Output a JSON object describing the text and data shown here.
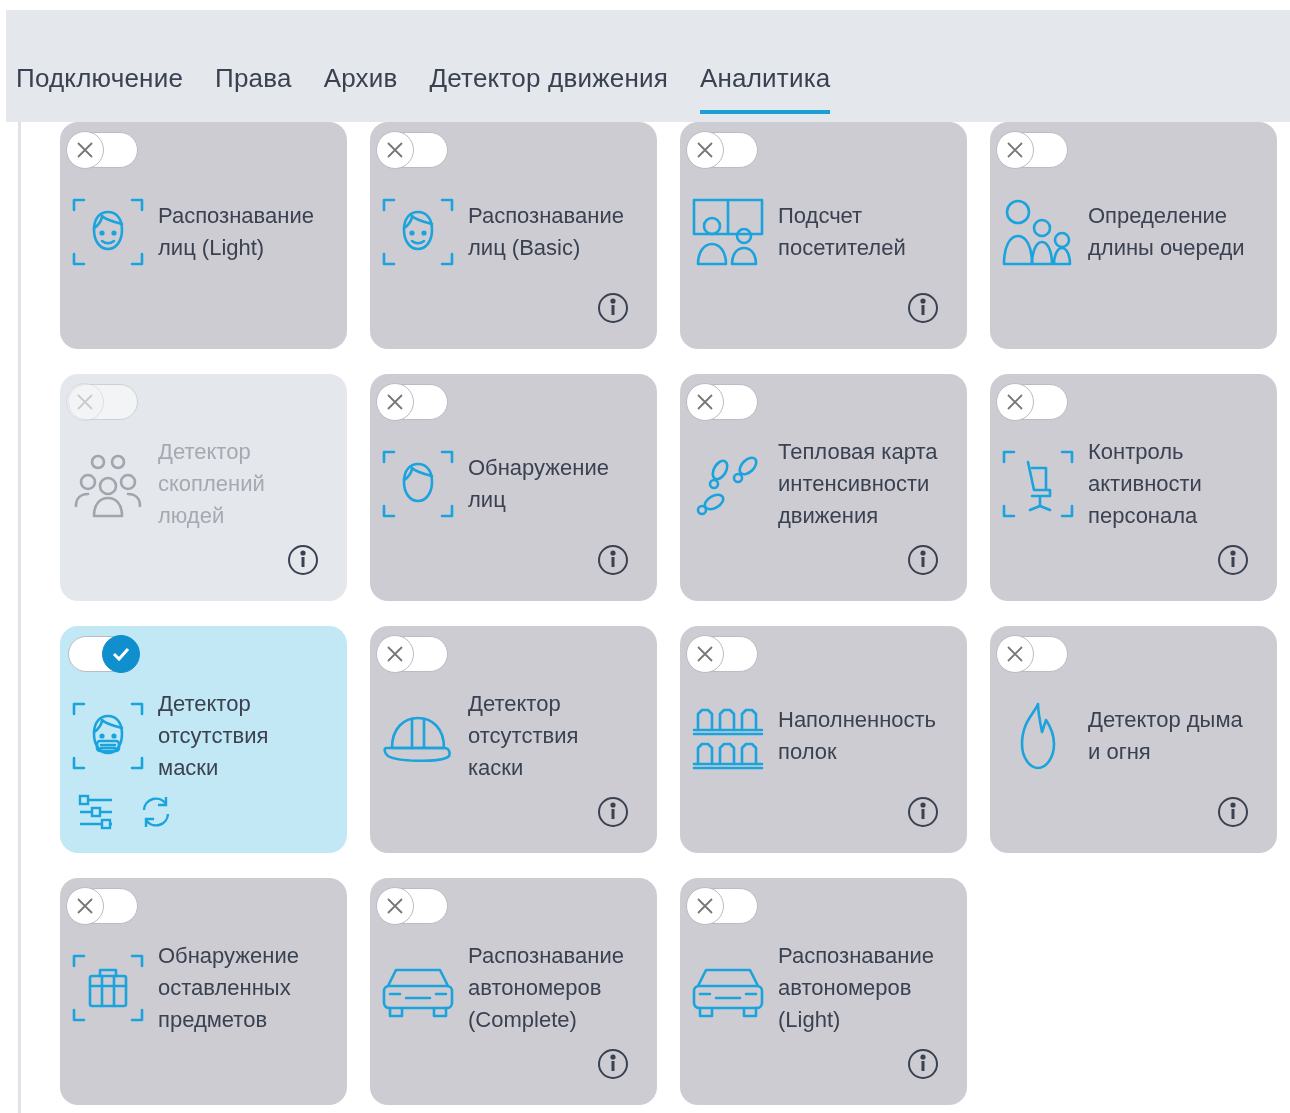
{
  "tabs": [
    {
      "label": "Подключение",
      "selected": false
    },
    {
      "label": "Права",
      "selected": false
    },
    {
      "label": "Архив",
      "selected": false
    },
    {
      "label": "Детектор движения",
      "selected": false
    },
    {
      "label": "Аналитика",
      "selected": true
    }
  ],
  "modules": [
    {
      "label": "Распознавание лиц (Light)",
      "kind": "face",
      "on": false,
      "disabled": false,
      "info": false,
      "actions": false
    },
    {
      "label": "Распознавание лиц (Basic)",
      "kind": "face",
      "on": false,
      "disabled": false,
      "info": true,
      "actions": false
    },
    {
      "label": "Подсчет посетителей",
      "kind": "visitors",
      "on": false,
      "disabled": false,
      "info": true,
      "actions": false
    },
    {
      "label": "Определение длины очереди",
      "kind": "queue",
      "on": false,
      "disabled": false,
      "info": false,
      "actions": false
    },
    {
      "label": "Детектор скоплений людей",
      "kind": "crowd",
      "on": false,
      "disabled": true,
      "info": true,
      "actions": false
    },
    {
      "label": "Обнаружение лиц",
      "kind": "head",
      "on": false,
      "disabled": false,
      "info": true,
      "actions": false
    },
    {
      "label": "Тепловая карта интенсивности движения",
      "kind": "footprints",
      "on": false,
      "disabled": false,
      "info": true,
      "actions": false
    },
    {
      "label": "Контроль активности персонала",
      "kind": "chair",
      "on": false,
      "disabled": false,
      "info": true,
      "actions": false
    },
    {
      "label": "Детектор отсутствия маски",
      "kind": "mask",
      "on": true,
      "disabled": false,
      "info": false,
      "actions": true
    },
    {
      "label": "Детектор отсутствия каски",
      "kind": "helmet",
      "on": false,
      "disabled": false,
      "info": true,
      "actions": false
    },
    {
      "label": "Наполненность полок",
      "kind": "shelves",
      "on": false,
      "disabled": false,
      "info": true,
      "actions": false
    },
    {
      "label": "Детектор дыма и огня",
      "kind": "fire",
      "on": false,
      "disabled": false,
      "info": true,
      "actions": false
    },
    {
      "label": "Обнаружение оставленных предметов",
      "kind": "luggage",
      "on": false,
      "disabled": false,
      "info": false,
      "actions": false
    },
    {
      "label": "Распознавание автономеров (Complete)",
      "kind": "car",
      "on": false,
      "disabled": false,
      "info": true,
      "actions": false
    },
    {
      "label": "Распознавание автономеров (Light)",
      "kind": "car",
      "on": false,
      "disabled": false,
      "info": true,
      "actions": false
    }
  ]
}
